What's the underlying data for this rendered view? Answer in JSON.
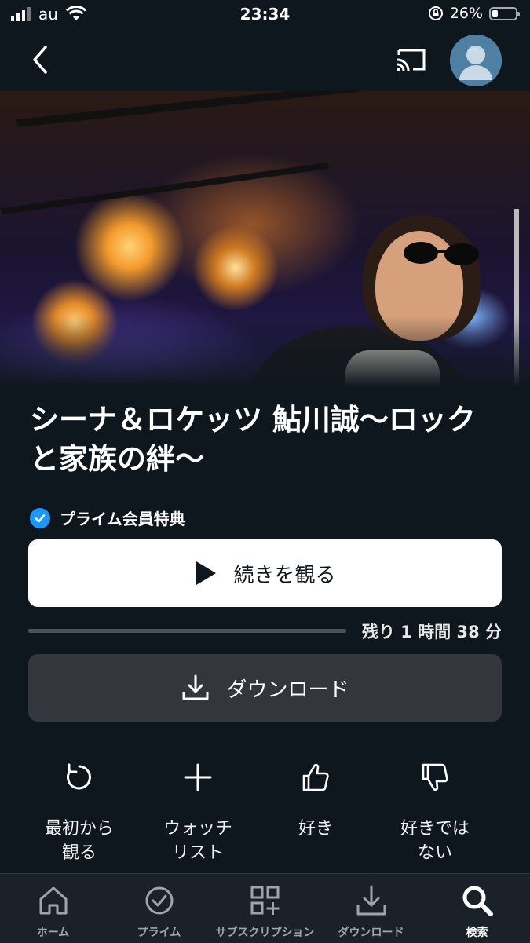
{
  "status_bar": {
    "carrier": "au",
    "time": "23:34",
    "battery": "26%",
    "battery_level": 0.26
  },
  "nav": {
    "back_icon": "chevron-left-icon",
    "cast_icon": "cast-icon",
    "avatar_icon": "user-avatar-icon"
  },
  "title": "シーナ＆ロケッツ 鮎川誠〜ロックと家族の絆〜",
  "prime_label": "プライム会員特典",
  "play_label": "続きを観る",
  "progress": {
    "watched_fraction": 0.0,
    "remaining": "残り 1 時間 38 分"
  },
  "download_label": "ダウンロード",
  "actions": [
    {
      "icon": "restart-icon",
      "label": "最初から\n観る"
    },
    {
      "icon": "plus-icon",
      "label": "ウォッチ\nリスト"
    },
    {
      "icon": "thumbs-up-icon",
      "label": "好き"
    },
    {
      "icon": "thumbs-down-icon",
      "label": "好きでは\nない"
    }
  ],
  "tabs": [
    {
      "icon": "home-icon",
      "label": "ホーム"
    },
    {
      "icon": "prime-check-icon",
      "label": "プライム"
    },
    {
      "icon": "subscriptions-icon",
      "label": "サブスクリプション"
    },
    {
      "icon": "download-icon",
      "label": "ダウンロード"
    },
    {
      "icon": "search-icon",
      "label": "検索",
      "active": true
    }
  ],
  "colors": {
    "background": "#0f171e",
    "prime_blue": "#1a98ff",
    "play_button": "#ffffff",
    "download_button": "#33373d",
    "tab_bar": "#1b2128"
  }
}
